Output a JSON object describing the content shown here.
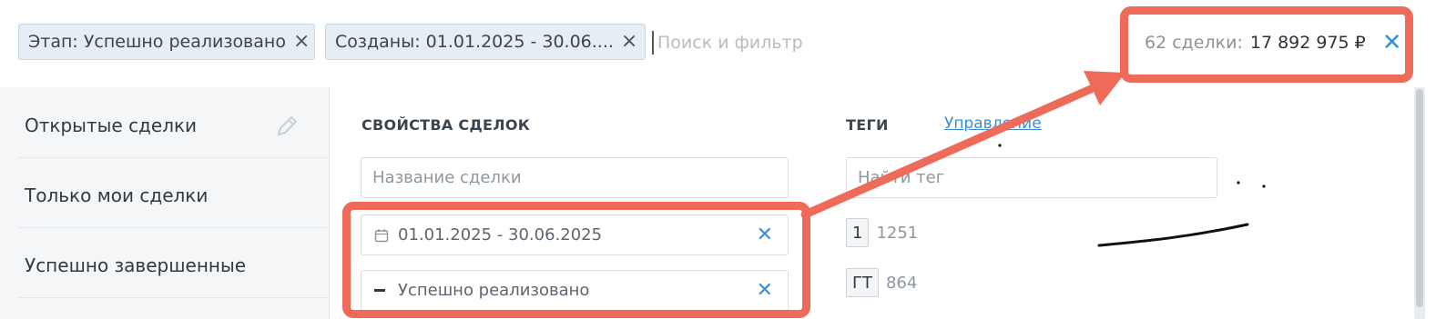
{
  "filters": {
    "chips": [
      {
        "label": "Этап: Успешно реализовано"
      },
      {
        "label": "Созданы: 01.01.2025 - 30.06...."
      }
    ],
    "chip_close_glyph": "×",
    "search_placeholder": "Поиск и фильтр"
  },
  "summary": {
    "count_label": "62 сделки:",
    "amount": "17 892 975 ₽",
    "close_glyph": "✕"
  },
  "sidebar": {
    "items": [
      {
        "label": "Открытые сделки"
      },
      {
        "label": "Только мои сделки"
      },
      {
        "label": "Успешно завершенные"
      }
    ]
  },
  "properties": {
    "title": "СВОЙСТВА СДЕЛОК",
    "name_placeholder": "Название сделки",
    "date_value": "01.01.2025 - 30.06.2025",
    "stage_value": "Успешно реализовано",
    "clear_glyph": "✕"
  },
  "tags": {
    "title": "ТЕГИ",
    "manage_link": "Управление",
    "search_placeholder": "Найти тег",
    "items": [
      {
        "badge": "1",
        "count": "1251"
      },
      {
        "badge": "ГТ",
        "count": "864"
      }
    ]
  },
  "colors": {
    "highlight": "#ee6b5a",
    "accent": "#3b8fd1"
  },
  "icons": [
    "calendar-icon",
    "minus-icon",
    "pencil-icon",
    "close-icon"
  ]
}
